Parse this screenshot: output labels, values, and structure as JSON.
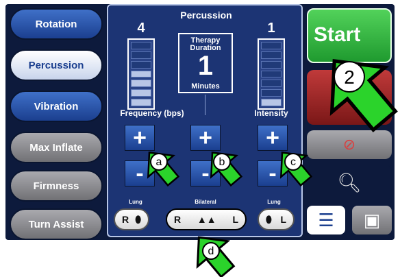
{
  "sidebar": {
    "items": [
      {
        "label": "Rotation"
      },
      {
        "label": "Percussion"
      },
      {
        "label": "Vibration"
      },
      {
        "label": "Max Inflate"
      },
      {
        "label": "Firmness"
      },
      {
        "label": "Turn Assist"
      }
    ]
  },
  "panel": {
    "title": "Percussion",
    "frequency": {
      "value": "4",
      "label": "Frequency (bps)",
      "level": 4,
      "segments": 7
    },
    "intensity": {
      "value": "1",
      "label": "Intensity",
      "level": 1,
      "segments": 7
    },
    "duration": {
      "line1": "Therapy",
      "line2": "Duration",
      "value": "1",
      "unit": "Minutes"
    },
    "controls": {
      "plus": "+",
      "minus": "-"
    },
    "lung": {
      "left_caption": "Lung",
      "center_caption": "Bilateral",
      "right_caption": "Lung",
      "r": "R",
      "l": "L"
    }
  },
  "right": {
    "start_label": "Start"
  },
  "annotations": {
    "a": "a",
    "b": "b",
    "c": "c",
    "d": "d",
    "two": "2"
  },
  "colors": {
    "start": "#3bb54a",
    "arrow": "#2bd32b",
    "panel": "#1c3474"
  }
}
